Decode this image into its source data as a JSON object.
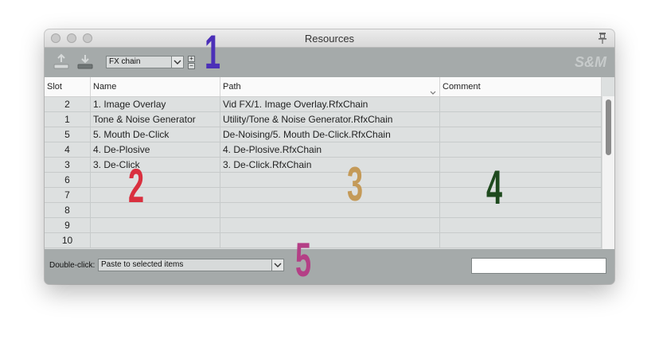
{
  "window": {
    "title": "Resources"
  },
  "toolbar": {
    "type_select": {
      "value": "FX chain"
    },
    "plus": "+",
    "minus": "−",
    "logo": "S&M"
  },
  "table": {
    "headers": {
      "slot": "Slot",
      "name": "Name",
      "path": "Path",
      "comment": "Comment"
    },
    "rows": [
      {
        "slot": "2",
        "name": "1. Image Overlay",
        "path": "Vid FX/1. Image Overlay.RfxChain",
        "comment": ""
      },
      {
        "slot": "1",
        "name": "Tone & Noise Generator",
        "path": "Utility/Tone & Noise Generator.RfxChain",
        "comment": ""
      },
      {
        "slot": "5",
        "name": "5. Mouth De-Click",
        "path": "De-Noising/5. Mouth De-Click.RfxChain",
        "comment": ""
      },
      {
        "slot": "4",
        "name": "4. De-Plosive",
        "path": "4. De-Plosive.RfxChain",
        "comment": ""
      },
      {
        "slot": "3",
        "name": "3. De-Click",
        "path": "3. De-Click.RfxChain",
        "comment": ""
      },
      {
        "slot": "6",
        "name": "",
        "path": "",
        "comment": ""
      },
      {
        "slot": "7",
        "name": "",
        "path": "",
        "comment": ""
      },
      {
        "slot": "8",
        "name": "",
        "path": "",
        "comment": ""
      },
      {
        "slot": "9",
        "name": "",
        "path": "",
        "comment": ""
      },
      {
        "slot": "10",
        "name": "",
        "path": "",
        "comment": ""
      }
    ]
  },
  "footer": {
    "double_click_label": "Double-click:",
    "double_click_select": {
      "value": "Paste to selected items"
    },
    "filter_value": ""
  },
  "annotations": [
    {
      "label": "1",
      "color": "#4b2fb8"
    },
    {
      "label": "2",
      "color": "#d9303f"
    },
    {
      "label": "3",
      "color": "#c49a58"
    },
    {
      "label": "4",
      "color": "#1e4a1e"
    },
    {
      "label": "5",
      "color": "#b43f86"
    }
  ],
  "colors": {
    "toolbar_bg": "#a5aaaa",
    "table_bg": "#dde0e0",
    "header_bg": "#fafafa"
  }
}
